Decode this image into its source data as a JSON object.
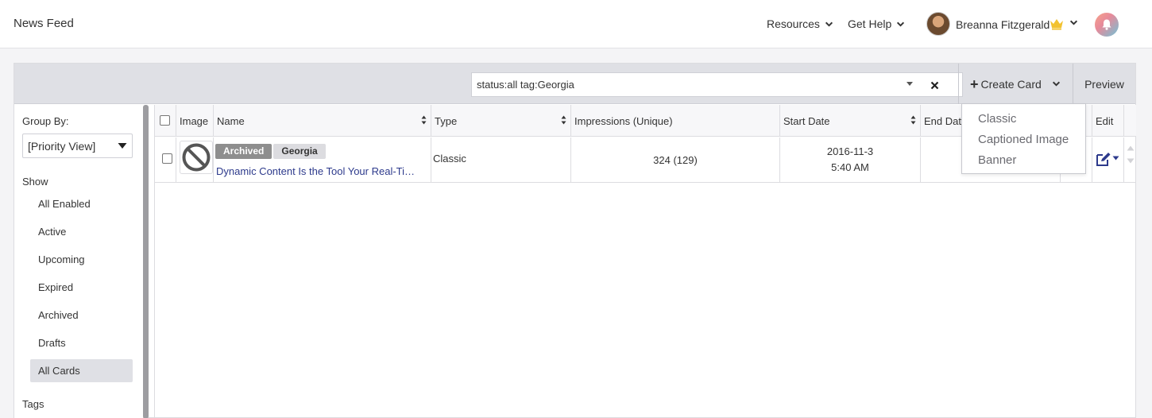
{
  "header": {
    "title": "News Feed",
    "resources_label": "Resources",
    "help_label": "Get Help",
    "user_name": "Breanna Fitzgerald"
  },
  "toolbar": {
    "search_value": "status:all tag:Georgia",
    "create_label": "Create Card",
    "preview_label": "Preview"
  },
  "create_menu": {
    "items": [
      "Classic",
      "Captioned Image",
      "Banner"
    ]
  },
  "sidebar": {
    "group_by_label": "Group By:",
    "group_by_value": "[Priority View]",
    "show_label": "Show",
    "filters": [
      "All Enabled",
      "Active",
      "Upcoming",
      "Expired",
      "Archived",
      "Drafts",
      "All Cards"
    ],
    "active_filter": "All Cards",
    "tags_label": "Tags"
  },
  "table": {
    "columns": [
      "Image",
      "Name",
      "Type",
      "Impressions (Unique)",
      "Start Date",
      "End Date",
      "Edit"
    ],
    "rows": [
      {
        "status_badge": "Archived",
        "tag": "Georgia",
        "name": "Dynamic Content Is the Tool Your Real-Ti…",
        "type": "Classic",
        "impressions": "324 (129)",
        "start_date": "2016-11-3",
        "start_time": "5:40 AM"
      }
    ]
  },
  "colors": {
    "accent": "#2d3a8c",
    "crown": "#f2c230",
    "archived_badge": "#8e8e8e"
  }
}
